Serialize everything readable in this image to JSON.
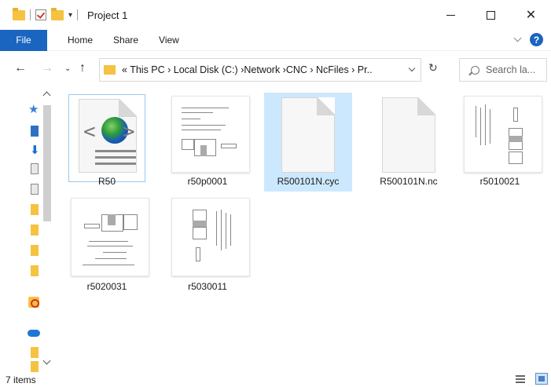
{
  "window": {
    "title": "Project 1",
    "controls": {
      "minimize": "minimize-icon",
      "maximize": "maximize-icon",
      "close": "✕"
    }
  },
  "ribbon": {
    "file_tab": "File",
    "tabs": [
      "Home",
      "Share",
      "View"
    ],
    "help": "?"
  },
  "address_bar": {
    "path": "« This PC › Local Disk (C:) ›Network ›CNC › NcFiles › Pr.."
  },
  "search": {
    "placeholder": "Search la..."
  },
  "files": [
    {
      "name": "R50",
      "kind": "html-icon"
    },
    {
      "name": "r50p0001",
      "kind": "drawing-landscape"
    },
    {
      "name": "R500101N.cyc",
      "kind": "blank-page"
    },
    {
      "name": "R500101N.nc",
      "kind": "blank-page"
    },
    {
      "name": "r5010021",
      "kind": "drawing-portrait"
    },
    {
      "name": "r5020031",
      "kind": "drawing-landscape-rotated"
    },
    {
      "name": "r5030011",
      "kind": "drawing-portrait"
    }
  ],
  "status": {
    "item_count": "7 items"
  },
  "colors": {
    "accent": "#1a65c0",
    "selection": "#cce8ff",
    "folder": "#f5c242"
  }
}
